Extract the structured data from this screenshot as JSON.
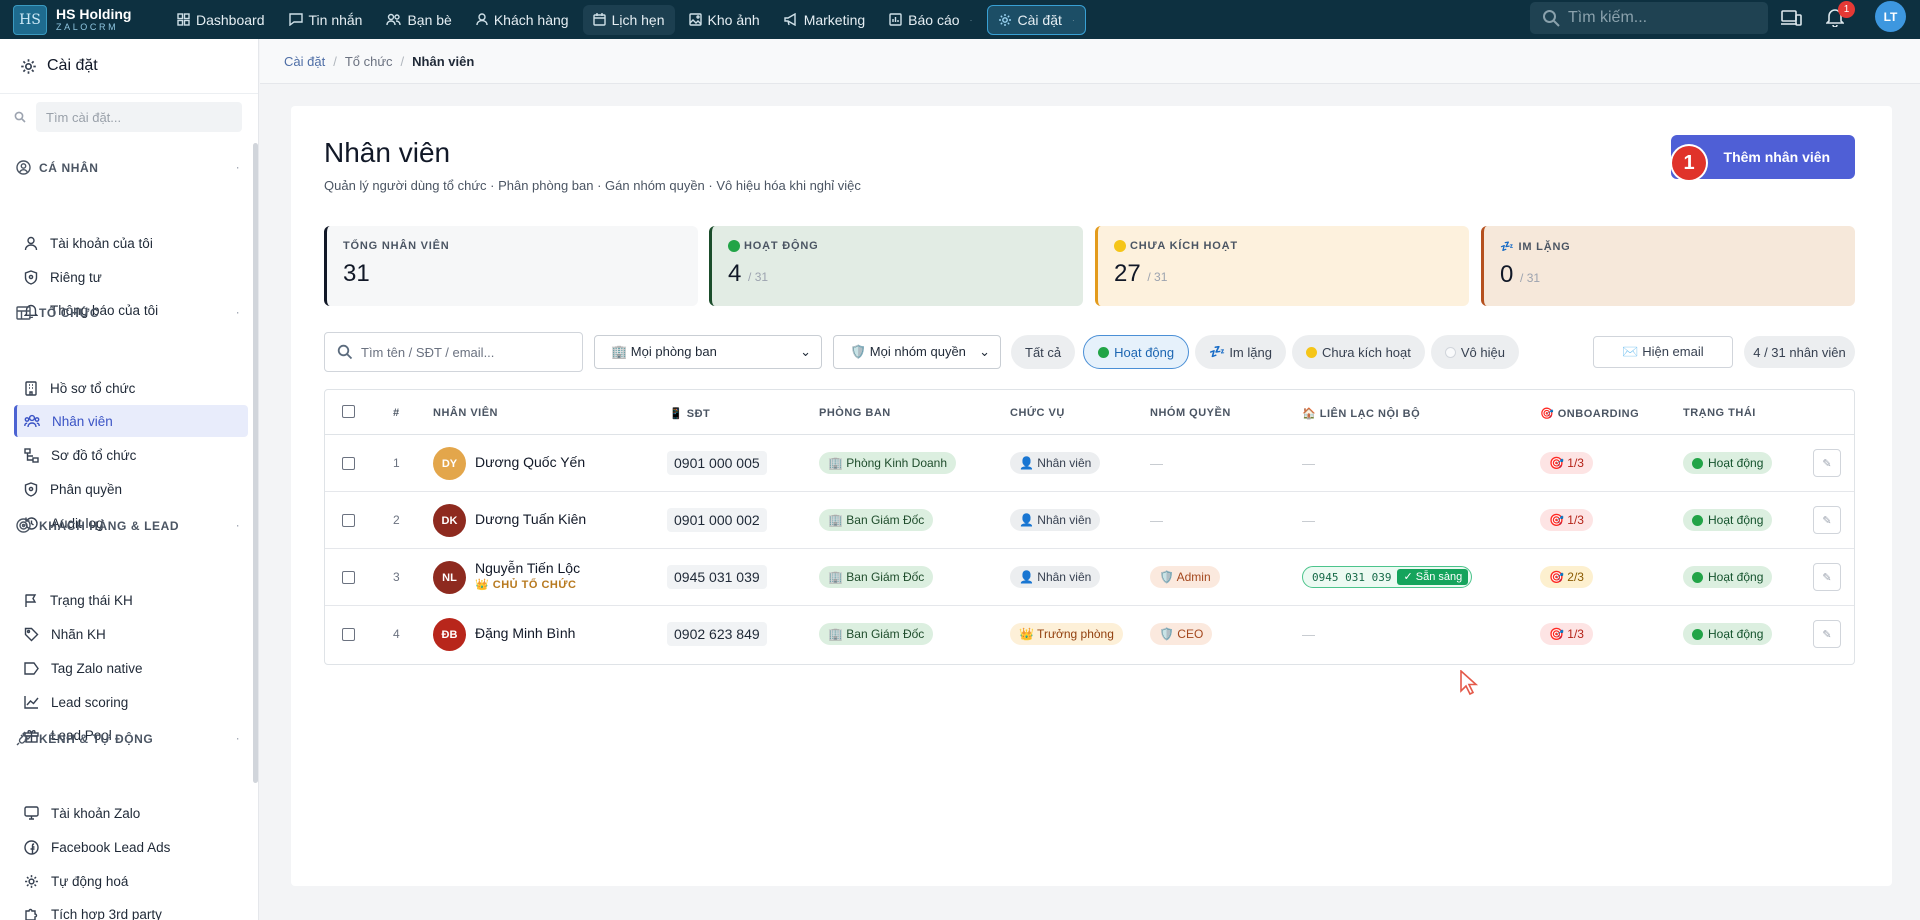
{
  "app": {
    "logo_mark": "HS",
    "name": "HS Holding",
    "sub": "ZALOCRM"
  },
  "nav": [
    {
      "label": "Dashboard",
      "icon": "grid-icon"
    },
    {
      "label": "Tin nhắn",
      "icon": "message-icon"
    },
    {
      "label": "Bạn bè",
      "icon": "friends-icon"
    },
    {
      "label": "Khách hàng",
      "icon": "user-icon"
    },
    {
      "label": "Lịch hẹn",
      "icon": "calendar-icon"
    },
    {
      "label": "Kho ảnh",
      "icon": "image-icon"
    },
    {
      "label": "Marketing",
      "icon": "megaphone-icon"
    },
    {
      "label": "Báo cáo",
      "icon": "report-icon"
    },
    {
      "label": "Cài đặt",
      "icon": "gear-icon"
    }
  ],
  "top": {
    "search_placeholder": "Tìm kiếm...",
    "notif_count": "1",
    "avatar": "LT"
  },
  "sidebar": {
    "title": "Cài đặt",
    "search_placeholder": "Tìm cài đặt...",
    "sections": [
      {
        "label": "CÁ NHÂN",
        "items": [
          "Tài khoản của tôi",
          "Riêng tư",
          "Thông báo của tôi"
        ]
      },
      {
        "label": "TỔ CHỨC",
        "items": [
          "Hồ sơ tổ chức",
          "Nhân viên",
          "Sơ đồ tổ chức",
          "Phân quyền",
          "Audit log"
        ]
      },
      {
        "label": "KHÁCH HÀNG & LEAD",
        "items": [
          "Trạng thái KH",
          "Nhãn KH",
          "Tag Zalo native",
          "Lead scoring",
          "Lead Pool"
        ]
      },
      {
        "label": "KÊNH & TỰ ĐỘNG",
        "items": [
          "Tài khoản Zalo",
          "Facebook Lead Ads",
          "Tự động hoá",
          "Tích hợp 3rd party"
        ]
      }
    ]
  },
  "breadcrumb": [
    "Cài đặt",
    "Tổ chức",
    "Nhân viên"
  ],
  "page": {
    "title": "Nhân viên",
    "subtitle": "Quản lý người dùng tổ chức · Phân phòng ban · Gán nhóm quyền · Vô hiệu hóa khi nghỉ việc",
    "add_button": "Thêm nhân viên",
    "step_badge": "1"
  },
  "stats": [
    {
      "label": "TỔNG NHÂN VIÊN",
      "value": "31",
      "of": ""
    },
    {
      "label": "HOẠT ĐỘNG",
      "value": "4",
      "of": "/ 31"
    },
    {
      "label": "CHƯA KÍCH HOẠT",
      "value": "27",
      "of": "/ 31"
    },
    {
      "label": "IM LẶNG",
      "value": "0",
      "of": "/ 31"
    }
  ],
  "filters": {
    "search_placeholder": "Tìm tên / SĐT / email...",
    "dept_select": "🏢 Mọi phòng ban",
    "group_select": "🛡️ Mọi nhóm quyền",
    "chips": [
      "Tất cả",
      "Hoạt động",
      "Im lặng",
      "Chưa kích hoạt",
      "Vô hiệu"
    ],
    "email_toggle": "✉️ Hiện email",
    "count": "4 / 31 nhân viên"
  },
  "table": {
    "headers": [
      "#",
      "NHÂN VIÊN",
      "📱 SĐT",
      "PHÒNG BAN",
      "CHỨC VỤ",
      "NHÓM QUYỀN",
      "🏠 LIÊN LẠC NỘI BỘ",
      "🎯 ONBOARDING",
      "TRẠNG THÁI"
    ],
    "rows": [
      {
        "idx": "1",
        "initials": "DY",
        "name": "Dương Quốc Yến",
        "owner": "",
        "phone": "0901 000 005",
        "dept": "🏢 Phòng Kinh Doanh",
        "role": "👤 Nhân viên",
        "group": "—",
        "contact": "—",
        "contact_ok": "",
        "onboarding": "🎯 1/3",
        "status": "Hoạt động"
      },
      {
        "idx": "2",
        "initials": "DK",
        "name": "Dương Tuấn Kiên",
        "owner": "",
        "phone": "0901 000 002",
        "dept": "🏢 Ban Giám Đốc",
        "role": "👤 Nhân viên",
        "group": "—",
        "contact": "—",
        "contact_ok": "",
        "onboarding": "🎯 1/3",
        "status": "Hoạt động"
      },
      {
        "idx": "3",
        "initials": "NL",
        "name": "Nguyễn Tiến Lộc",
        "owner": "👑 CHỦ TỔ CHỨC",
        "phone": "0945 031 039",
        "dept": "🏢 Ban Giám Đốc",
        "role": "👤 Nhân viên",
        "group": "🛡️ Admin",
        "contact": "0945 031 039",
        "contact_ok": "✓ Sẵn sàng",
        "onboarding": "🎯 2/3",
        "status": "Hoạt động"
      },
      {
        "idx": "4",
        "initials": "ĐB",
        "name": "Đặng Minh Bình",
        "owner": "",
        "phone": "0902 623 849",
        "dept": "🏢 Ban Giám Đốc",
        "role": "👑 Trưởng phòng",
        "group": "🛡️ CEO",
        "contact": "—",
        "contact_ok": "",
        "onboarding": "🎯 1/3",
        "status": "Hoạt động"
      }
    ]
  },
  "colors": {
    "accent": "#4f5fd6",
    "topbar": "#0d3040",
    "active_green": "#22a447"
  }
}
